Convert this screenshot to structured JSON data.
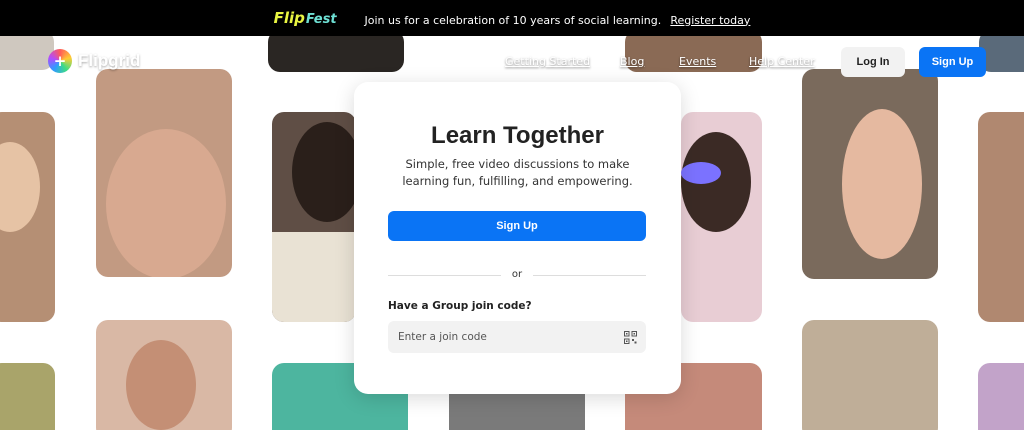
{
  "banner": {
    "brand_part1": "Flip",
    "brand_part2": "Fest",
    "message": "Join us for a celebration of 10 years of social learning.",
    "link": "Register today"
  },
  "nav": {
    "logo_text": "Flipgrid",
    "logo_icon": "plus-icon",
    "links": [
      "Getting Started",
      "Blog",
      "Events",
      "Help Center"
    ],
    "login": "Log In",
    "signup": "Sign Up"
  },
  "card": {
    "title": "Learn Together",
    "subtitle": "Simple, free video discussions to make learning fun, fulfilling, and empowering.",
    "signup": "Sign Up",
    "or": "or",
    "join_label": "Have a Group join code?",
    "join_placeholder": "Enter a join code",
    "qr_icon": "qr-code-icon"
  },
  "colors": {
    "banner_bg": "#000000",
    "accent": "#0a74f5",
    "button_light": "#f2f2f2"
  }
}
